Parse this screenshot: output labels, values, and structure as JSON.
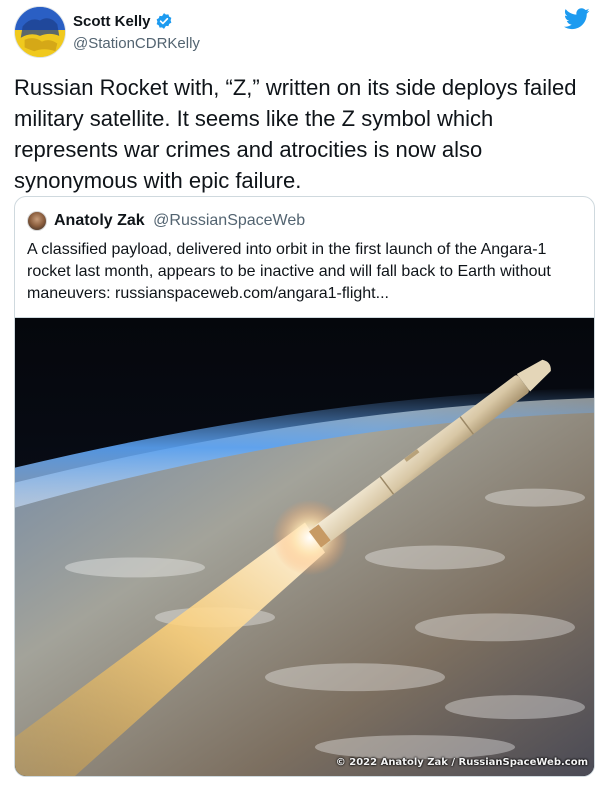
{
  "author": {
    "name": "Scott Kelly",
    "handle": "@StationCDRKelly",
    "verified": true,
    "avatar_icon": "avatar-ukraine-flag"
  },
  "brand": {
    "icon": "twitter-bird-icon",
    "color": "#1d9bf0"
  },
  "tweet": {
    "text": "Russian Rocket with, “Z,” written on its side deploys failed military satellite. It seems like the Z symbol which represents war crimes and atrocities is now also synonymous with epic failure."
  },
  "quoted_tweet": {
    "name": "Anatoly Zak",
    "handle": "@RussianSpaceWeb",
    "text": "A classified payload, delivered into orbit in the first launch of the Angara-1 rocket last month, appears to be inactive and will fall back to Earth without maneuvers: russianspaceweb.com/angara1-flight...",
    "image": {
      "icon": "rocket-launch-image",
      "credit": "© 2022 Anatoly Zak / RussianSpaceWeb.com"
    }
  },
  "colors": {
    "text_primary": "#0f1419",
    "text_secondary": "#536471",
    "verified_badge": "#1d9bf0",
    "border": "#cfd9de"
  }
}
